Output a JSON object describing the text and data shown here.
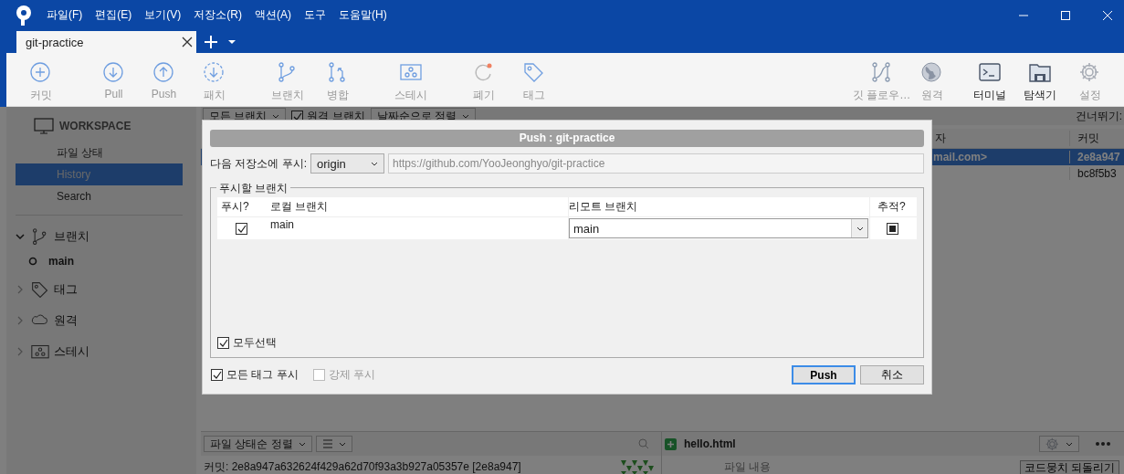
{
  "window": {
    "menu": [
      "파일(F)",
      "편집(E)",
      "보기(V)",
      "저장소(R)",
      "액션(A)",
      "도구",
      "도움말(H)"
    ]
  },
  "tabs": [
    {
      "label": "git-practice",
      "selected": true
    }
  ],
  "toolbar": {
    "left": [
      [
        {
          "label": "커밋",
          "highlighted": false
        }
      ],
      [
        {
          "label": "Pull",
          "highlighted": false
        },
        {
          "label": "Push",
          "highlighted": false
        },
        {
          "label": "패치",
          "highlighted": false
        }
      ],
      [
        {
          "label": "브랜치",
          "highlighted": false
        },
        {
          "label": "병합",
          "highlighted": false
        }
      ],
      [
        {
          "label": "스테시",
          "highlighted": false
        }
      ],
      [
        {
          "label": "폐기",
          "highlighted": false
        },
        {
          "label": "태그",
          "highlighted": false
        }
      ]
    ],
    "right": [
      [
        {
          "label": "깃 플로우…",
          "highlighted": false
        },
        {
          "label": "원격",
          "highlighted": false
        }
      ],
      [
        {
          "label": "터미널",
          "highlighted": true
        },
        {
          "label": "탐색기",
          "highlighted": true
        },
        {
          "label": "설정",
          "highlighted": false
        }
      ]
    ]
  },
  "sidebar": {
    "workspace": "WORKSPACE",
    "items": [
      {
        "label": "파일 상태",
        "selected": false
      },
      {
        "label": "History",
        "selected": true
      },
      {
        "label": "Search",
        "selected": false
      }
    ],
    "sections": [
      {
        "label": "브랜치",
        "expanded": true,
        "children": [
          {
            "label": "main",
            "current": true
          }
        ]
      },
      {
        "label": "태그",
        "expanded": false
      },
      {
        "label": "원격",
        "expanded": false
      },
      {
        "label": "스테시",
        "expanded": false
      }
    ]
  },
  "history": {
    "filters": [
      {
        "kind": "dropdown",
        "label": "모든 브랜치"
      },
      {
        "kind": "checkbox",
        "label": "원격 브랜치",
        "checked": true
      },
      {
        "kind": "dropdown",
        "label": "날짜순으로 정렬"
      }
    ],
    "skip_label": "건너뛰기:",
    "columns": [
      "자",
      "커밋"
    ],
    "rows": [
      {
        "column_1": "mail.com>",
        "commit": "2e8a947",
        "selected": true
      },
      {
        "commit": "bc8f5b3",
        "selected": false
      }
    ]
  },
  "files": {
    "sort": "파일 상태순 정렬",
    "commit_line": "커밋: 2e8a947a632624f429a62d70f93a3b927a05357e [2e8a947]",
    "file": "hello.html",
    "content_label": "파일 내용",
    "revert_button": "코드뭉치 되돌리기"
  },
  "dialog": {
    "title": "Push :  git-practice",
    "remote_label": "다음 저장소에 푸시:",
    "remote": "origin",
    "url": "https://github.com/YooJeonghyo/git-practice",
    "group": "푸시할 브랜치",
    "columns": [
      "푸시?",
      "로컬 브랜치",
      "리모트 브랜치",
      "추적?"
    ],
    "rows": [
      {
        "push": true,
        "local": "main",
        "remote": "main",
        "track": true
      }
    ],
    "select_all": {
      "label": "모두선택",
      "checked": true
    },
    "options": [
      {
        "label": "모든 태그 푸시",
        "checked": true,
        "disabled": false
      },
      {
        "label": "강제 푸시",
        "checked": false,
        "disabled": true
      }
    ],
    "buttons": [
      {
        "label": "Push",
        "default": true
      },
      {
        "label": "취소",
        "default": false
      }
    ]
  }
}
